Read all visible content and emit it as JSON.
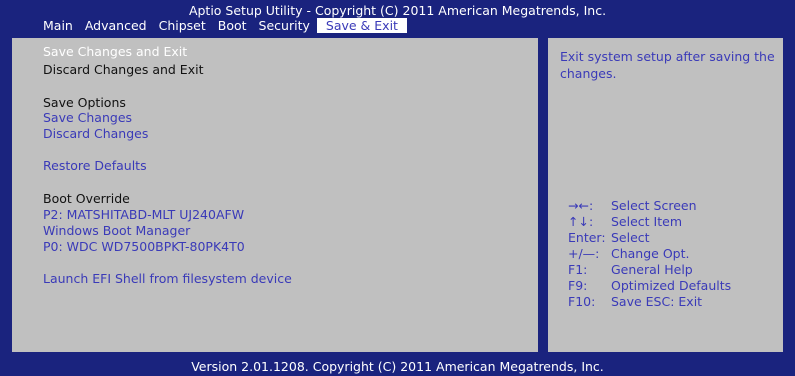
{
  "header": {
    "title": "Aptio Setup Utility - Copyright (C) 2011 American Megatrends, Inc.",
    "tabs": [
      "Main",
      "Advanced",
      "Chipset",
      "Boot",
      "Security",
      "Save & Exit"
    ],
    "active_tab": "Save & Exit"
  },
  "menu": {
    "save_changes_and_exit": "Save Changes and Exit",
    "discard_changes_and_exit": "Discard Changes and Exit",
    "save_options_heading": "Save Options",
    "save_changes": "Save Changes",
    "discard_changes": "Discard Changes",
    "restore_defaults": "Restore Defaults",
    "boot_override_heading": "Boot Override",
    "boot_p2": "P2:  MATSHITABD-MLT UJ240AFW",
    "boot_windows": "Windows Boot Manager",
    "boot_p0": "P0:  WDC WD7500BPKT-80PK4T0",
    "launch_efi": "Launch EFI Shell from filesystem device"
  },
  "help": {
    "description": "Exit system setup after saving the changes.",
    "keys": [
      {
        "key": "→←:",
        "desc": "Select Screen"
      },
      {
        "key": "↑↓:",
        "desc": "Select Item"
      },
      {
        "key": "Enter:",
        "desc": "Select"
      },
      {
        "key": "+/—:",
        "desc": "Change Opt."
      },
      {
        "key": "F1:",
        "desc": "General Help"
      },
      {
        "key": "F9:",
        "desc": "Optimized Defaults"
      },
      {
        "key": "F10:",
        "desc": "Save   ESC: Exit"
      }
    ]
  },
  "footer": {
    "text": "Version 2.01.1208. Copyright (C) 2011 American Megatrends, Inc."
  },
  "colors": {
    "background": "#1a237e",
    "panel": "#c0c0c0",
    "accent": "#3a3ab8",
    "selected_text": "#ffffff"
  }
}
